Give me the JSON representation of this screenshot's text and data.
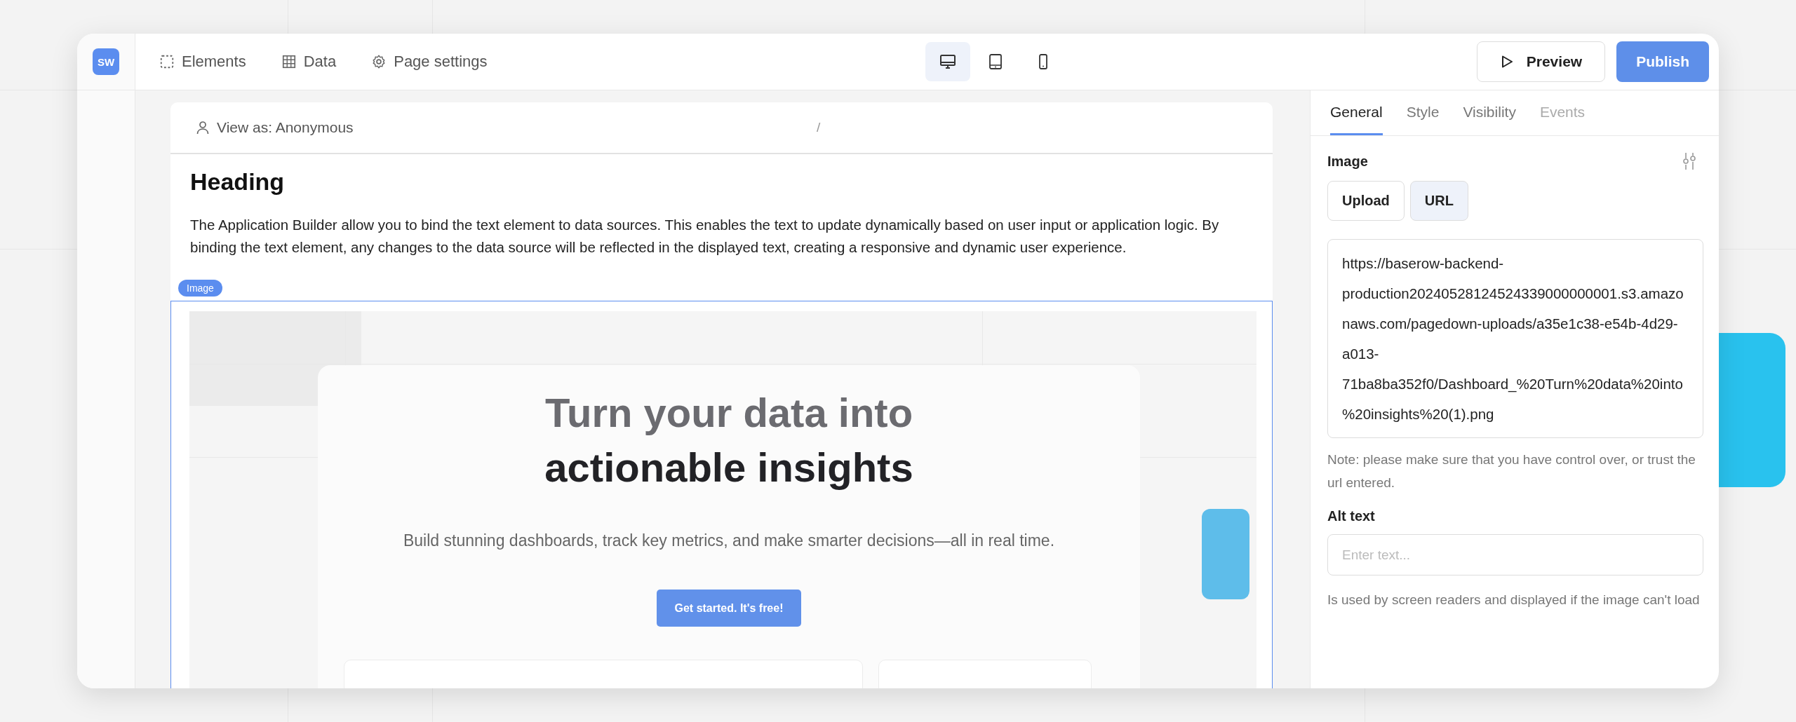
{
  "logo": {
    "text": "SW"
  },
  "nav": [
    {
      "label": "Elements"
    },
    {
      "label": "Data"
    },
    {
      "label": "Page settings"
    }
  ],
  "devices": [
    {
      "selected": true
    },
    {
      "selected": false
    },
    {
      "selected": false
    }
  ],
  "actions": {
    "preview": "Preview",
    "publish": "Publish"
  },
  "page": {
    "view_as": "View as: Anonymous",
    "path": "/",
    "heading": "Heading",
    "paragraph": "The Application Builder allow you to bind the text element to data sources. This enables the text to update dynamically based on user input or application logic. By binding the text element, any changes to the data source will be reflected in the displayed text, creating a responsive and dynamic user experience.",
    "element_badge": "Image",
    "preview": {
      "title_line_1": "Turn your data into",
      "title_line_2": "actionable insights",
      "subtitle": "Build stunning dashboards, track key metrics, and make smarter decisions—all in real time.",
      "button": "Get started. It's free!"
    }
  },
  "panel": {
    "tabs": [
      {
        "label": "General",
        "selected": true,
        "disabled": false
      },
      {
        "label": "Style",
        "selected": false,
        "disabled": false
      },
      {
        "label": "Visibility",
        "selected": false,
        "disabled": false
      },
      {
        "label": "Events",
        "selected": false,
        "disabled": true
      }
    ],
    "image_label": "Image",
    "sources": [
      {
        "label": "Upload",
        "selected": false
      },
      {
        "label": "URL",
        "selected": true
      }
    ],
    "url": "https://baserow-backend-production20240528124524339000000001.s3.amazonaws.com/pagedown-uploads/a35e1c38-e54b-4d29-a013-71ba8ba352f0/Dashboard_%20Turn%20data%20into%20insights%20(1).png",
    "note": "Note: please make sure that you have control over, or trust the url entered.",
    "alt_label": "Alt text",
    "alt_placeholder": "Enter text...",
    "alt_help": "Is used by screen readers and displayed if the image can't load"
  }
}
